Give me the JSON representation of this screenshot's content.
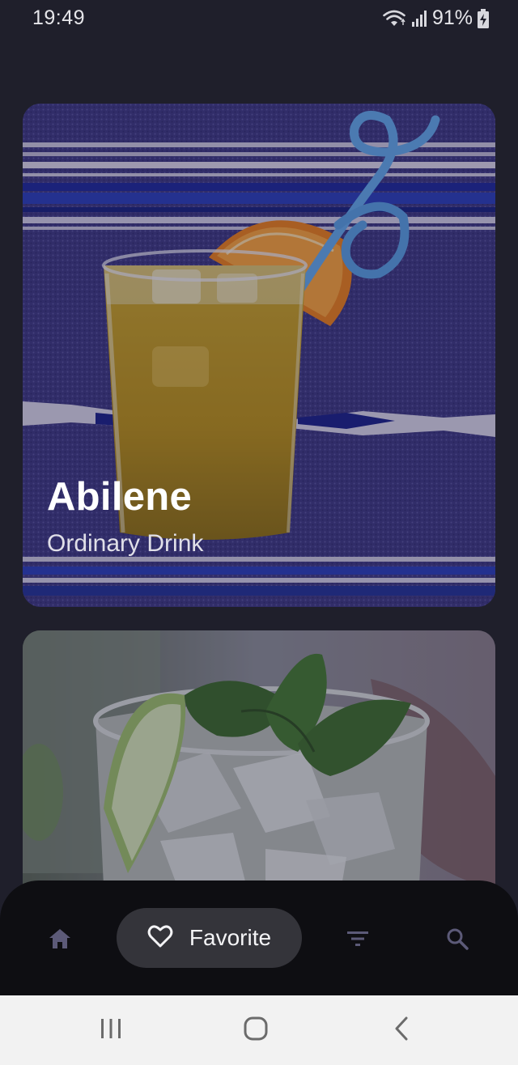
{
  "status_bar": {
    "time": "19:49",
    "battery": "91%",
    "icons": [
      "wifi-icon",
      "signal-icon",
      "battery-charging-icon"
    ]
  },
  "cards": [
    {
      "title": "Abilene",
      "subtitle": "Ordinary Drink",
      "image": "orange-cocktail-photo"
    },
    {
      "title": "",
      "subtitle": "",
      "image": "mojito-cocktail-photo"
    }
  ],
  "bottom_nav": {
    "items": [
      {
        "icon": "home-icon"
      },
      {
        "icon": "heart-icon",
        "label": "Favorite",
        "active": true
      },
      {
        "icon": "filter-icon"
      },
      {
        "icon": "search-icon"
      }
    ]
  },
  "system_nav": {
    "icons": [
      "recent-apps-icon",
      "home-button-icon",
      "back-icon"
    ]
  },
  "colors": {
    "background": "#1f1f2b",
    "nav_background": "#0e0e12",
    "active_pill": "#34343a",
    "inactive_icon": "#5c5a78",
    "system_nav": "#f2f2f2"
  }
}
